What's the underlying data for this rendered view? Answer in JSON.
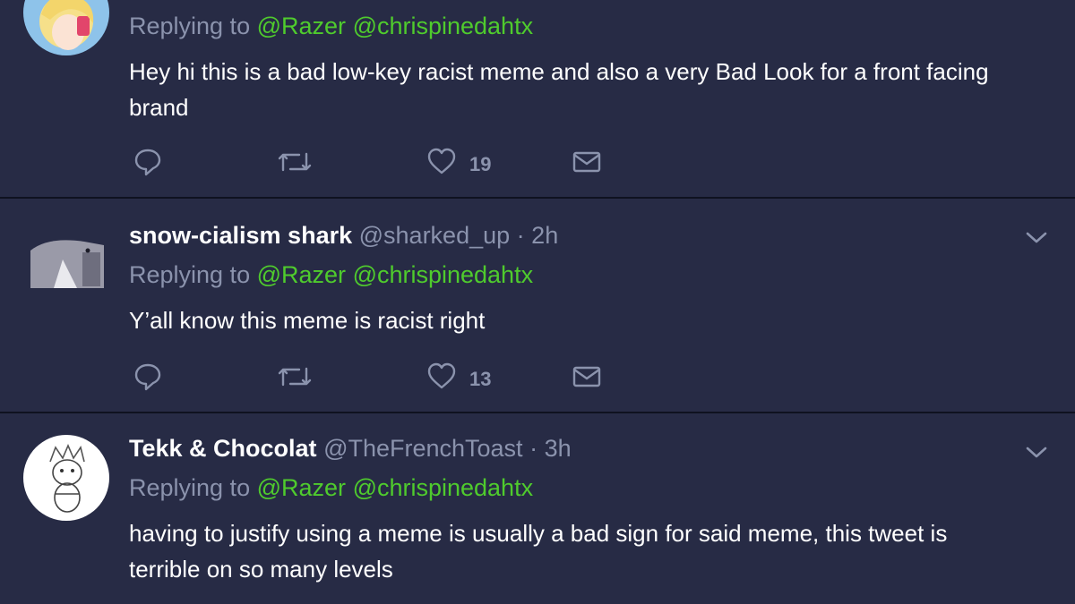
{
  "tweets": [
    {
      "replying_label": "Replying to",
      "mentions": [
        "@Razer",
        "@chrispinedahtx"
      ],
      "text": "Hey hi this is a bad low-key racist meme and also a very Bad Look for a front facing brand",
      "likes": "19",
      "avatar_icon": "anime-avatar"
    },
    {
      "name": "snow-cialism shark",
      "handle": "@sharked_up",
      "separator": "·",
      "time": "2h",
      "replying_label": "Replying to",
      "mentions": [
        "@Razer",
        "@chrispinedahtx"
      ],
      "text": "Y’all know this meme is racist right",
      "likes": "13",
      "avatar_icon": "shark-avatar"
    },
    {
      "name": "Tekk & Chocolat",
      "handle": "@TheFrenchToast",
      "separator": "·",
      "time": "3h",
      "replying_label": "Replying to",
      "mentions": [
        "@Razer",
        "@chrispinedahtx"
      ],
      "text": "having to justify using a meme is usually a bad sign for said meme, this tweet is terrible on so many levels",
      "avatar_icon": "sketch-avatar"
    }
  ],
  "colors": {
    "background": "#272b45",
    "mention": "#4fcb2d",
    "muted": "#8b93ad",
    "divider": "#0f1220"
  },
  "icons": [
    "reply-icon",
    "retweet-icon",
    "like-icon",
    "direct-message-icon",
    "chevron-down-icon"
  ]
}
